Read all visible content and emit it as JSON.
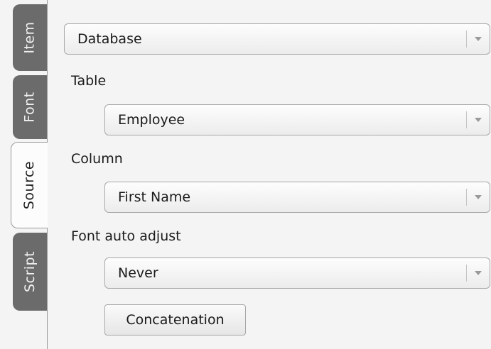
{
  "tabs": [
    {
      "label": "Item"
    },
    {
      "label": "Font"
    },
    {
      "label": "Source"
    },
    {
      "label": "Script"
    }
  ],
  "active_tab": "Source",
  "source": {
    "source_type": {
      "value": "Database"
    },
    "table": {
      "label": "Table",
      "value": "Employee"
    },
    "column": {
      "label": "Column",
      "value": "First Name"
    },
    "font_auto_adjust": {
      "label": "Font auto adjust",
      "value": "Never"
    },
    "concatenation_label": "Concatenation"
  }
}
